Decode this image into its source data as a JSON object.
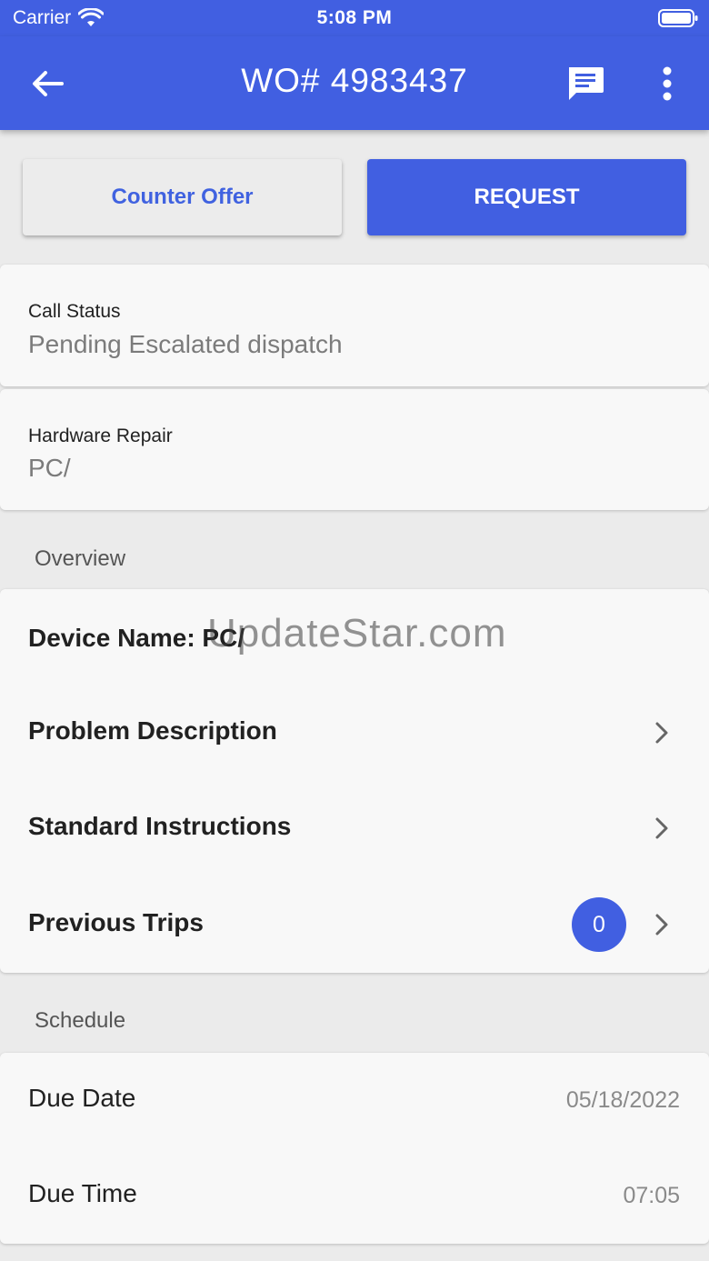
{
  "status_bar": {
    "carrier": "Carrier",
    "time": "5:08 PM"
  },
  "app_bar": {
    "title": "WO# 4983437",
    "back_icon": "arrow-left-icon",
    "chat_icon": "chat-icon",
    "more_icon": "more-vertical-icon"
  },
  "actions": {
    "counter_offer_label": "Counter Offer",
    "request_label": "REQUEST"
  },
  "call_status": {
    "label": "Call Status",
    "value": "Pending Escalated dispatch"
  },
  "hardware_repair": {
    "label": "Hardware Repair",
    "value": "PC/"
  },
  "overview": {
    "title": "Overview",
    "device_name": "Device Name: PC/",
    "problem_description": "Problem Description",
    "standard_instructions": "Standard Instructions",
    "previous_trips": "Previous Trips",
    "previous_trips_count": "0"
  },
  "schedule": {
    "title": "Schedule",
    "due_date_label": "Due Date",
    "due_date_value": "05/18/2022",
    "due_time_label": "Due Time",
    "due_time_value": "07:05"
  },
  "watermark": "UpdateStar.com",
  "colors": {
    "primary": "#415fe1",
    "background": "#ebebeb",
    "card": "#f8f8f8"
  }
}
